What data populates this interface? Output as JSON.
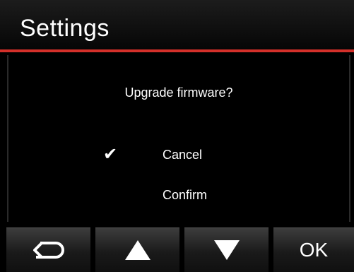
{
  "header": {
    "title": "Settings"
  },
  "dialog": {
    "question": "Upgrade firmware?",
    "options": [
      {
        "label": "Cancel",
        "selected": true
      },
      {
        "label": "Confirm",
        "selected": false
      }
    ],
    "selected_mark": "✔"
  },
  "toolbar": {
    "back_icon": "return-arrow-icon",
    "up_icon": "triangle-up-icon",
    "down_icon": "triangle-down-icon",
    "ok_label": "OK"
  },
  "colors": {
    "accent": "#d4302a",
    "background": "#000000",
    "text": "#ffffff"
  }
}
